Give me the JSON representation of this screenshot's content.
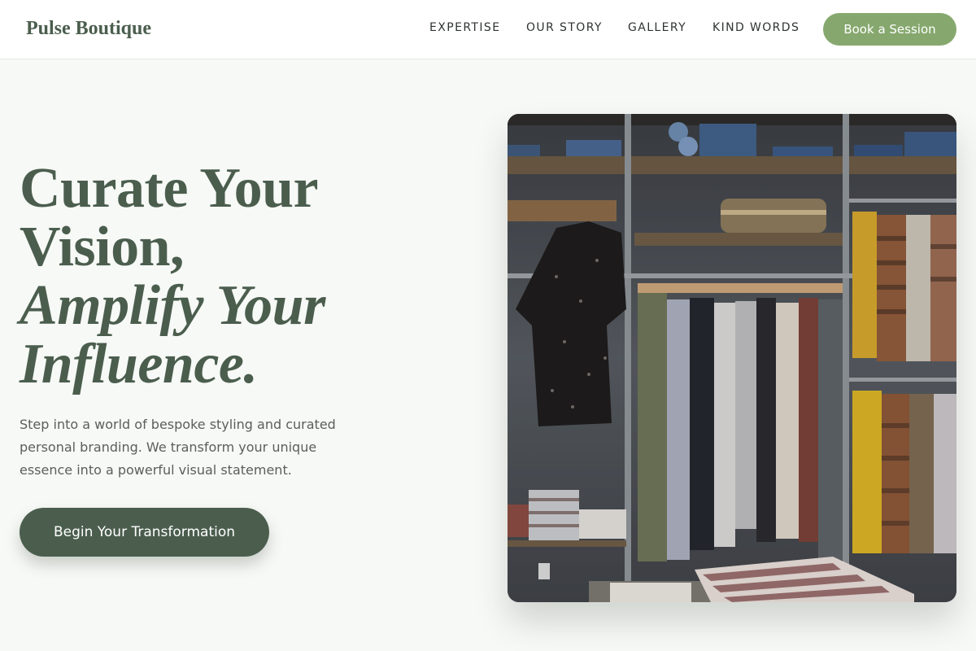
{
  "header": {
    "brand": "Pulse Boutique",
    "nav": [
      "EXPERTISE",
      "OUR STORY",
      "GALLERY",
      "KIND WORDS"
    ],
    "cta": "Book a Session"
  },
  "hero": {
    "headline_line1": "Curate Your",
    "headline_line2": "Vision,",
    "headline_line3": "Amplify Your",
    "headline_line4": "Influence.",
    "subtext": "Step into a world of bespoke styling and curated personal branding. We transform your unique essence into a powerful visual statement.",
    "cta": "Begin Your Transformation",
    "image_subject": "clothing rack in boutique"
  },
  "colors": {
    "accent_green": "#86a86e",
    "dark_green": "#4b5e4e",
    "background": "#f7f9f6"
  }
}
